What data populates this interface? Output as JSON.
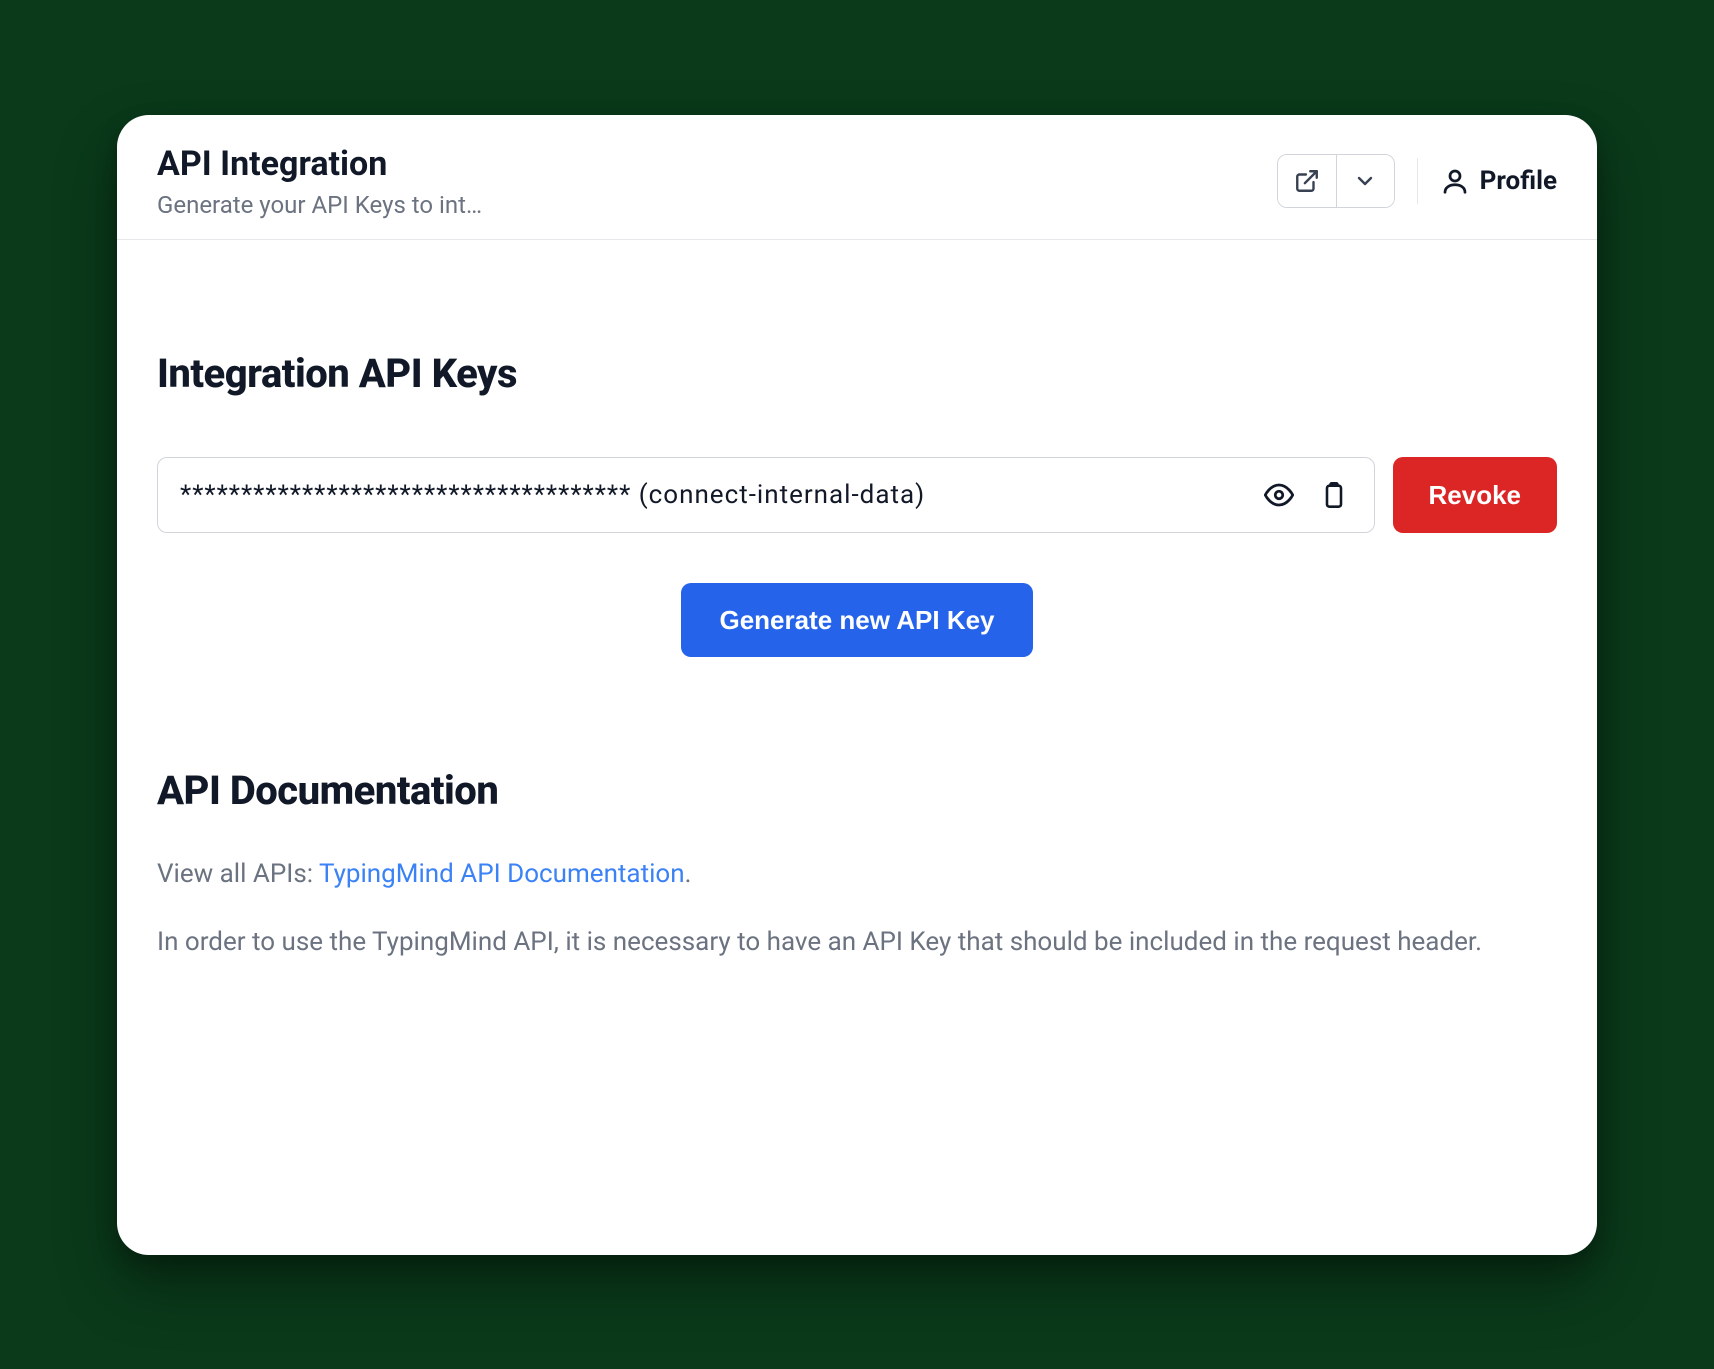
{
  "header": {
    "title": "API Integration",
    "subtitle": "Generate your API Keys to int…",
    "profile_label": "Profile"
  },
  "keys": {
    "heading": "Integration API Keys",
    "masked_value": "************************************* (connect-internal-data)",
    "revoke_label": "Revoke",
    "generate_label": "Generate new API Key"
  },
  "docs": {
    "heading": "API Documentation",
    "intro_prefix": "View all APIs: ",
    "link_text": "TypingMind API Documentation",
    "intro_suffix": ".",
    "body": "In order to use the TypingMind API, it is necessary to have an API Key that should be included in the request header."
  },
  "colors": {
    "primary": "#2563eb",
    "danger": "#dc2626",
    "text": "#111827",
    "muted": "#6b7280",
    "border": "#d1d5db"
  }
}
